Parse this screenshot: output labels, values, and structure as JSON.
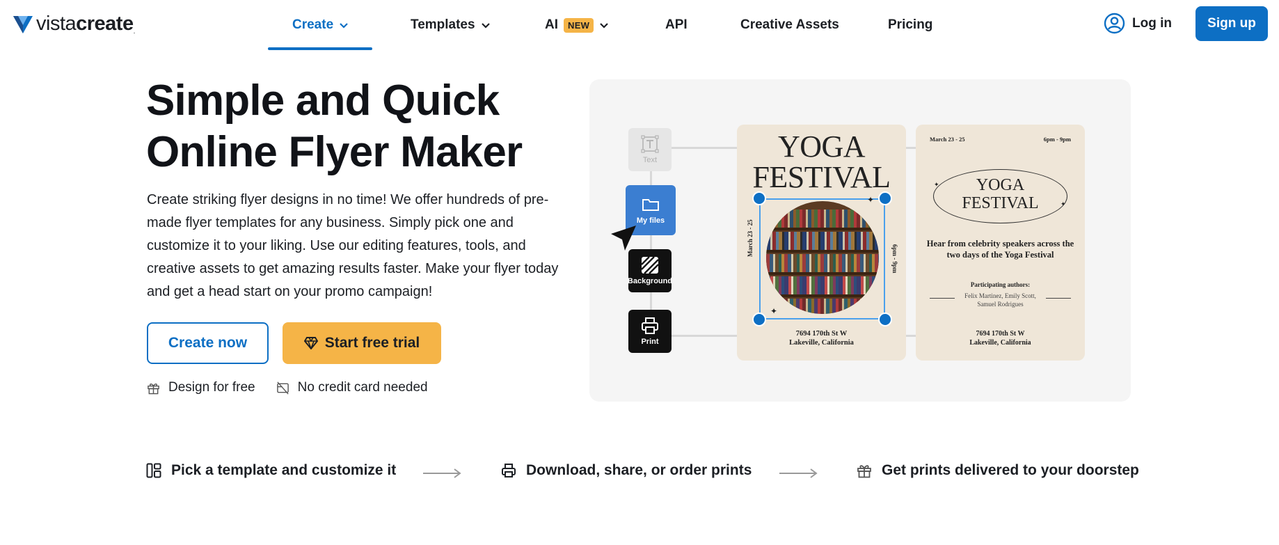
{
  "brand": {
    "name_light": "vista",
    "name_bold": "create",
    "accent": "#0d6fc4",
    "cta": "#f5b447"
  },
  "nav": {
    "items": [
      {
        "label": "Create",
        "has_dropdown": true,
        "active": true
      },
      {
        "label": "Templates",
        "has_dropdown": true
      },
      {
        "label": "AI",
        "badge": "NEW",
        "has_dropdown": true
      },
      {
        "label": "API"
      },
      {
        "label": "Creative Assets"
      },
      {
        "label": "Pricing"
      }
    ],
    "login_label": "Log in",
    "signup_label": "Sign up"
  },
  "hero": {
    "title_line1": "Simple and Quick",
    "title_line2": "Online Flyer Maker",
    "description": "Create striking flyer designs in no time! We offer hundreds of pre-made flyer templates for any business. Simply pick one and customize it to your liking. Use our editing features, tools, and creative assets to get amazing results faster. Make your flyer today and get a head start on your promo campaign!",
    "create_button": "Create now",
    "trial_button": "Start free trial",
    "perks": [
      "Design for free",
      "No credit card needed"
    ]
  },
  "illustration": {
    "tools": [
      {
        "label": "Text",
        "icon": "text-box-icon"
      },
      {
        "label": "My files",
        "icon": "folder-icon"
      },
      {
        "label": "Background",
        "icon": "background-stripes-icon"
      },
      {
        "label": "Print",
        "icon": "printer-icon"
      }
    ],
    "flyer1": {
      "title_line1": "YOGA",
      "title_line2": "FESTIVAL",
      "side_left": "March 23 - 25",
      "side_right": "6pm - 9pm",
      "address_line1": "7694 170th St W",
      "address_line2": "Lakeville, California"
    },
    "flyer2": {
      "date": "March 23 - 25",
      "time": "6pm - 9pm",
      "title_line1": "YOGA",
      "title_line2": "FESTIVAL",
      "tagline": "Hear from celebrity speakers across the two days of the Yoga Festival",
      "authors_label": "Participating authors:",
      "authors": "Felix Martinez, Emily Scott, Samuel Rodrigues",
      "address_line1": "7694 170th St W",
      "address_line2": "Lakeville, California"
    }
  },
  "steps": [
    {
      "label": "Pick a template and customize it",
      "icon": "template-layout-icon"
    },
    {
      "label": "Download, share, or order prints",
      "icon": "printer-icon"
    },
    {
      "label": "Get prints delivered to your doorstep",
      "icon": "gift-icon"
    }
  ]
}
